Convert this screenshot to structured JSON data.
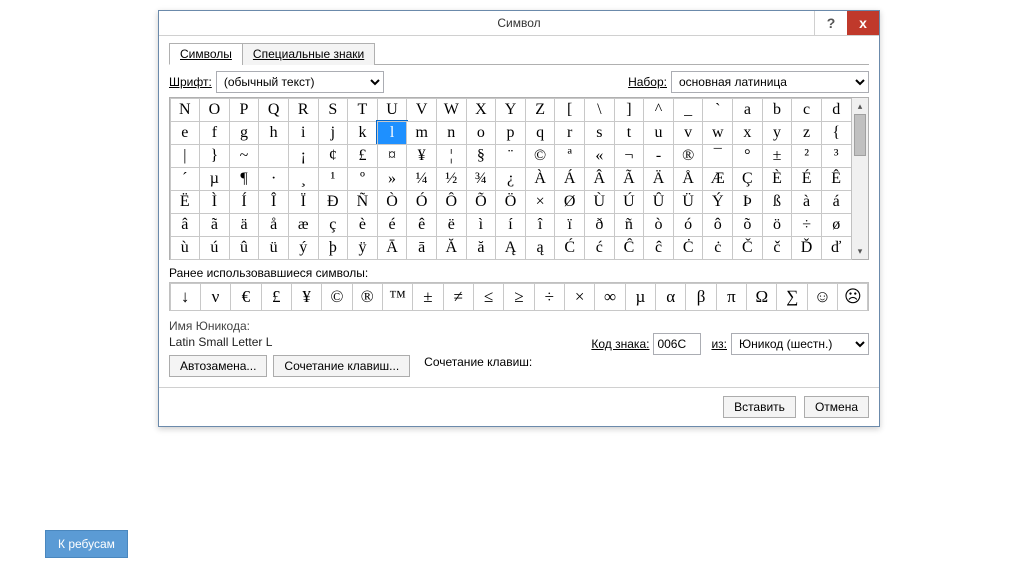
{
  "title": "Символ",
  "help_btn": "?",
  "close_btn": "х",
  "tabs": {
    "symbols": "Символы",
    "special": "Специальные знаки"
  },
  "font_label": "Шрифт:",
  "font_value": "(обычный текст)",
  "set_label": "Набор:",
  "set_value": "основная латиница",
  "grid_rows": [
    [
      "N",
      "O",
      "P",
      "Q",
      "R",
      "S",
      "T",
      "U",
      "V",
      "W",
      "X",
      "Y",
      "Z",
      "[",
      "\\",
      "]",
      "^",
      "_",
      "`",
      "a",
      "b",
      "c",
      "d"
    ],
    [
      "e",
      "f",
      "g",
      "h",
      "i",
      "j",
      "k",
      "l",
      "m",
      "n",
      "o",
      "p",
      "q",
      "r",
      "s",
      "t",
      "u",
      "v",
      "w",
      "x",
      "y",
      "z",
      "{"
    ],
    [
      "|",
      "}",
      "~",
      "",
      "¡",
      "¢",
      "£",
      "¤",
      "¥",
      "¦",
      "§",
      "¨",
      "©",
      "ª",
      "«",
      "¬",
      "-",
      "®",
      "¯",
      "°",
      "±",
      "²",
      "³"
    ],
    [
      "´",
      "µ",
      "¶",
      "·",
      "¸",
      "¹",
      "º",
      "»",
      "¼",
      "½",
      "¾",
      "¿",
      "À",
      "Á",
      "Â",
      "Ã",
      "Ä",
      "Å",
      "Æ",
      "Ç",
      "È",
      "É",
      "Ê"
    ],
    [
      "Ë",
      "Ì",
      "Í",
      "Î",
      "Ï",
      "Ð",
      "Ñ",
      "Ò",
      "Ó",
      "Ô",
      "Õ",
      "Ö",
      "×",
      "Ø",
      "Ù",
      "Ú",
      "Û",
      "Ü",
      "Ý",
      "Þ",
      "ß",
      "à",
      "á"
    ],
    [
      "â",
      "ã",
      "ä",
      "å",
      "æ",
      "ç",
      "è",
      "é",
      "ê",
      "ë",
      "ì",
      "í",
      "î",
      "ï",
      "ð",
      "ñ",
      "ò",
      "ó",
      "ô",
      "õ",
      "ö",
      "÷",
      "ø"
    ],
    [
      "ù",
      "ú",
      "û",
      "ü",
      "ý",
      "þ",
      "ÿ",
      "Ā",
      "ā",
      "Ă",
      "ă",
      "Ą",
      "ą",
      "Ć",
      "ć",
      "Ĉ",
      "ĉ",
      "Ċ",
      "ċ",
      "Č",
      "č",
      "Ď",
      "ď"
    ]
  ],
  "selected_row": 1,
  "selected_col": 7,
  "recent_label": "Ранее использовавшиеся символы:",
  "recent": [
    "↓",
    "ν",
    "€",
    "£",
    "¥",
    "©",
    "®",
    "™",
    "±",
    "≠",
    "≤",
    "≥",
    "÷",
    "×",
    "∞",
    "µ",
    "α",
    "β",
    "π",
    "Ω",
    "∑",
    "☺",
    "☹"
  ],
  "unicode_name_label": "Имя Юникода:",
  "unicode_name_value": "Latin Small Letter L",
  "code_label": "Код знака:",
  "code_value": "006C",
  "from_label": "из:",
  "from_value": "Юникод (шестн.)",
  "btn_autocorrect": "Автозамена...",
  "btn_shortcut": "Сочетание клавиш...",
  "shortcut_label": "Сочетание клавиш:",
  "btn_insert": "Вставить",
  "btn_cancel": "Отмена",
  "ext_button": "К ребусам"
}
